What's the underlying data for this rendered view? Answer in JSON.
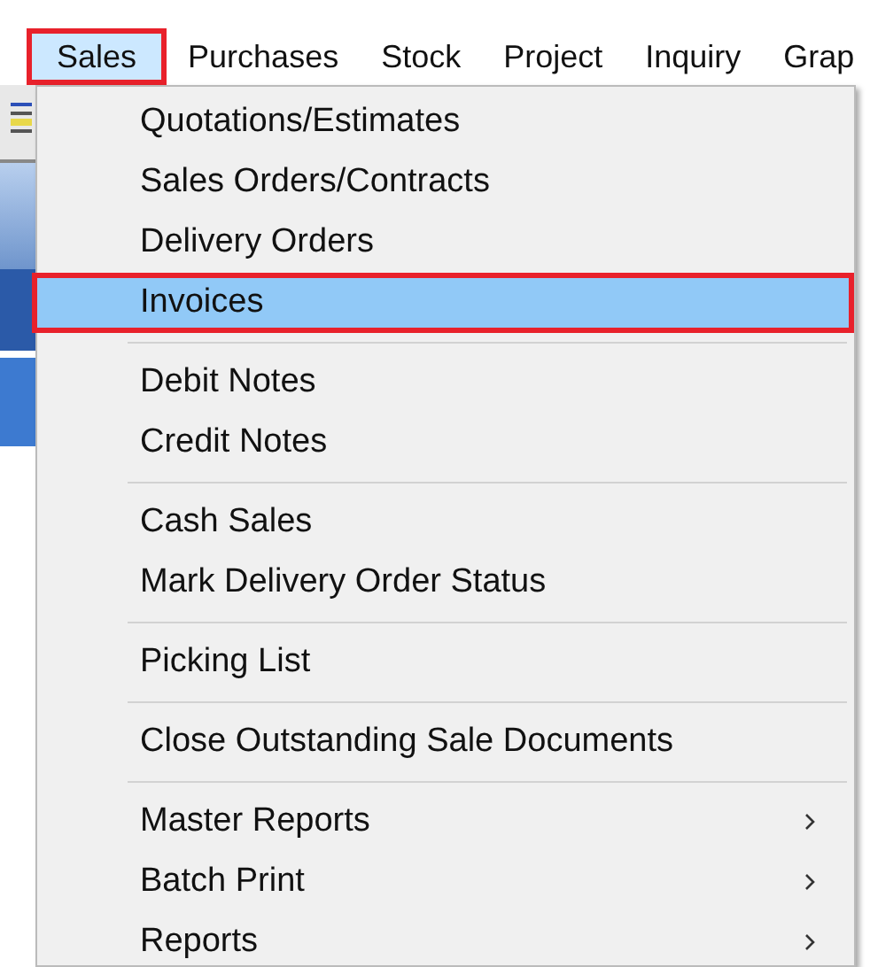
{
  "menubar": [
    {
      "label": "Sales",
      "selected": true,
      "outlined": true
    },
    {
      "label": "Purchases",
      "selected": false,
      "outlined": false
    },
    {
      "label": "Stock",
      "selected": false,
      "outlined": false
    },
    {
      "label": "Project",
      "selected": false,
      "outlined": false
    },
    {
      "label": "Inquiry",
      "selected": false,
      "outlined": false
    },
    {
      "label": "Grap",
      "selected": false,
      "outlined": false
    }
  ],
  "menu": {
    "groups": [
      {
        "items": [
          {
            "label": "Quotations/Estimates",
            "selected": false,
            "outlined": false,
            "submenu": false
          },
          {
            "label": "Sales Orders/Contracts",
            "selected": false,
            "outlined": false,
            "submenu": false
          },
          {
            "label": "Delivery Orders",
            "selected": false,
            "outlined": false,
            "submenu": false
          },
          {
            "label": "Invoices",
            "selected": true,
            "outlined": true,
            "submenu": false
          }
        ]
      },
      {
        "items": [
          {
            "label": "Debit Notes",
            "selected": false,
            "outlined": false,
            "submenu": false
          },
          {
            "label": "Credit Notes",
            "selected": false,
            "outlined": false,
            "submenu": false
          }
        ]
      },
      {
        "items": [
          {
            "label": "Cash Sales",
            "selected": false,
            "outlined": false,
            "submenu": false
          },
          {
            "label": "Mark Delivery Order Status",
            "selected": false,
            "outlined": false,
            "submenu": false
          }
        ]
      },
      {
        "items": [
          {
            "label": "Picking List",
            "selected": false,
            "outlined": false,
            "submenu": false
          }
        ]
      },
      {
        "items": [
          {
            "label": "Close Outstanding Sale Documents",
            "selected": false,
            "outlined": false,
            "submenu": false
          }
        ]
      },
      {
        "items": [
          {
            "label": "Master Reports",
            "selected": false,
            "outlined": false,
            "submenu": true
          },
          {
            "label": "Batch Print",
            "selected": false,
            "outlined": false,
            "submenu": true
          },
          {
            "label": "Reports",
            "selected": false,
            "outlined": false,
            "submenu": true
          }
        ]
      }
    ]
  }
}
